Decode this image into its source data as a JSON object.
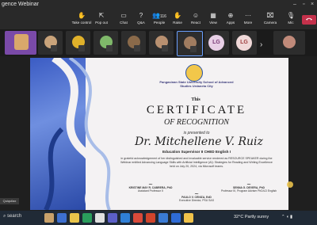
{
  "window": {
    "title": "gence Webinar"
  },
  "toolbar": {
    "items": [
      {
        "label": "Take control",
        "icon": "take-control-icon"
      },
      {
        "label": "Pop out",
        "icon": "pop-out-icon"
      },
      {
        "label": "Chat",
        "icon": "chat-icon"
      },
      {
        "label": "Q&A",
        "icon": "qa-icon"
      },
      {
        "label": "People",
        "icon": "people-icon",
        "count": "116"
      },
      {
        "label": "Raise",
        "icon": "raise-hand-icon"
      },
      {
        "label": "React",
        "icon": "react-icon"
      },
      {
        "label": "View",
        "icon": "view-icon"
      },
      {
        "label": "Apps",
        "icon": "apps-icon"
      },
      {
        "label": "More",
        "icon": "more-icon"
      },
      {
        "label": "Camera",
        "icon": "camera-off-icon"
      },
      {
        "label": "Mic",
        "icon": "mic-off-icon"
      }
    ]
  },
  "gallery": {
    "initials": [
      "LG",
      "LG"
    ]
  },
  "certificate": {
    "university": "Pangasinan State University School of Advanced Studies Urdaneta City",
    "this": "This",
    "title": "CERTIFICATE",
    "subtitle": "OF RECOGNITION",
    "presented": "is presented to",
    "name": "Dr. Mitchellene V. Ruiz",
    "role": "Education Supervisor II CHED English I",
    "body": "in grateful acknowledgement of her distinguished and invaluable service rendered as RESOURCE SPEAKER during the Webinar entitled Advancing Language Skills with Artificial Intelligence (AI): Strategies for Reading and Writing Excellence held on July 20, 2024, via Microsoft teams.",
    "signatories": [
      {
        "name": "KRISTINE MAY R. CABRERA, PhD",
        "title": "Assistant Professor II"
      },
      {
        "name": "PAULO V. CENIZA, EdD",
        "title": "Executive Director, PSU SAS"
      },
      {
        "name": "SENNA G. DEVERA, PhD",
        "title": "Professor III, Program Adviser PhD/LD English"
      }
    ]
  },
  "quiz_label": "Quiquilax",
  "taskbar": {
    "search": "search",
    "weather": "32°C Partly sunny"
  },
  "colors": {
    "leave": "#c4314b",
    "cert_blue": "#2b4aa8"
  }
}
